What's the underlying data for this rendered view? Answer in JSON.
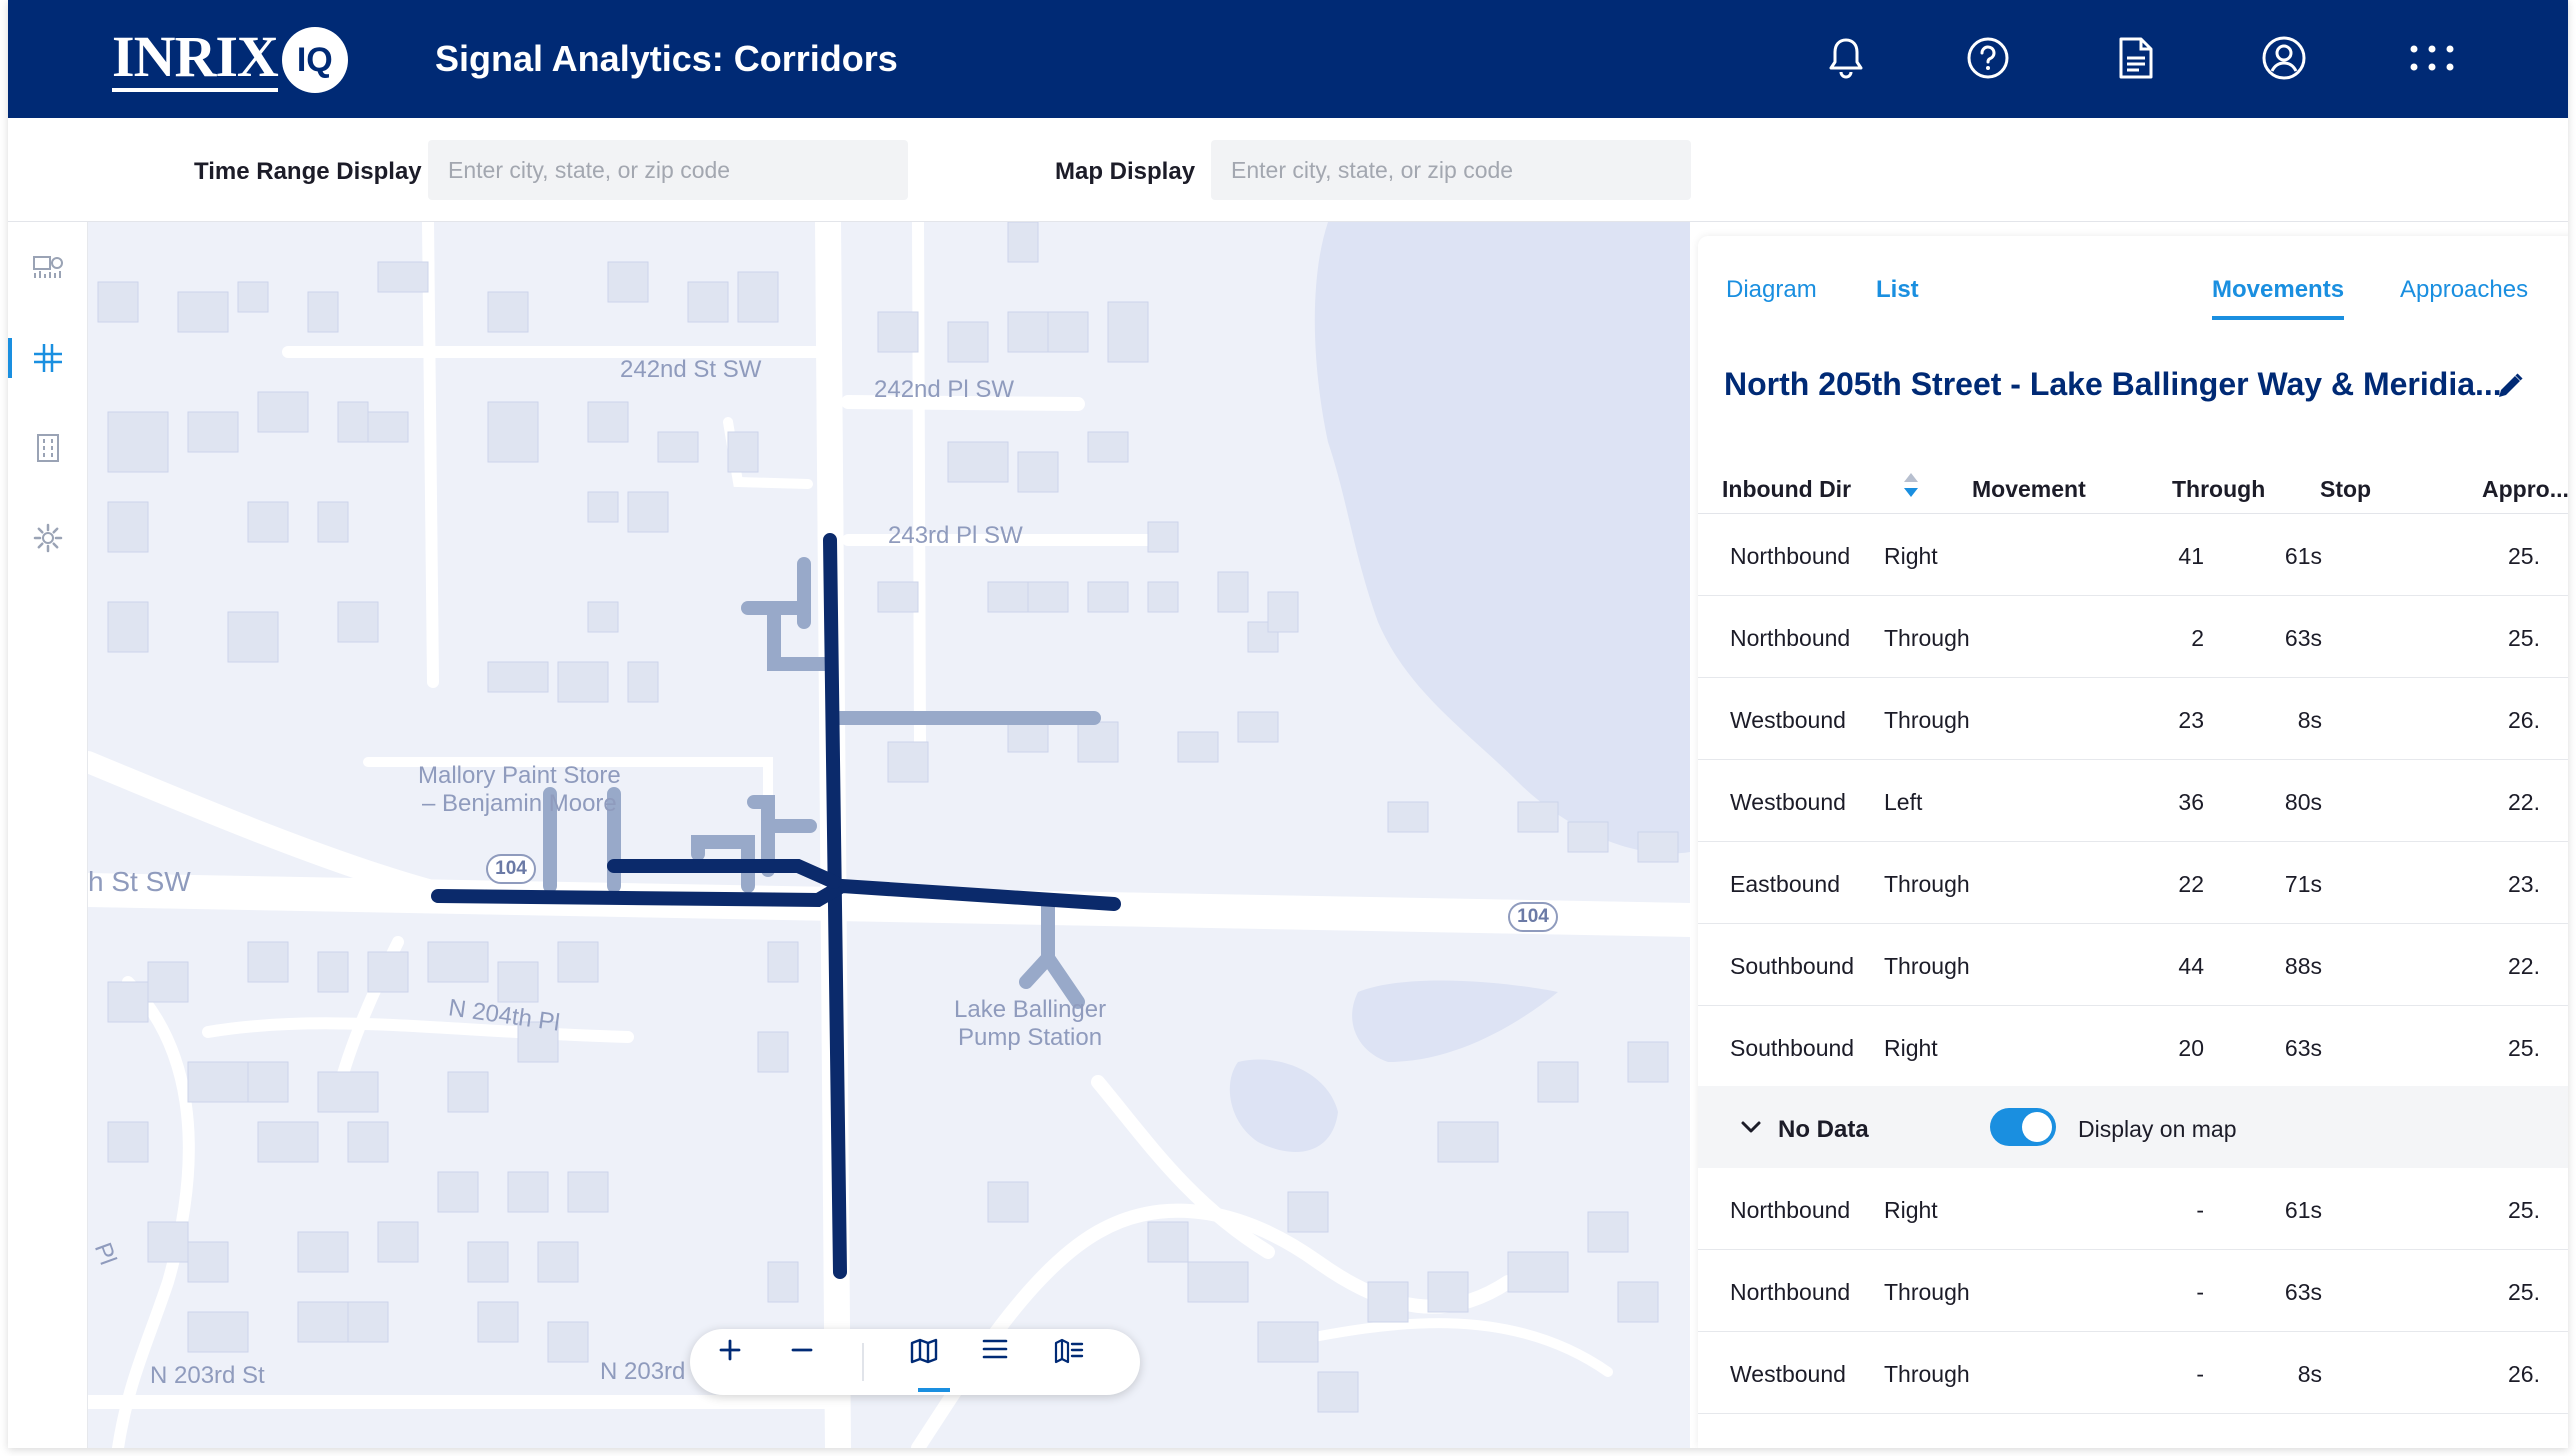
{
  "header": {
    "logo_text": "INRIX",
    "logo_badge": "IQ",
    "title": "Signal Analytics: Corridors",
    "icons": [
      "bell-icon",
      "help-icon",
      "document-icon",
      "account-icon",
      "apps-grid-icon"
    ]
  },
  "filters": {
    "time_range_label": "Time Range Display",
    "time_range_placeholder": "Enter city, state, or zip code",
    "map_display_label": "Map Display",
    "map_display_placeholder": "Enter city, state, or zip code"
  },
  "rail": {
    "items": [
      "dashboard-icon",
      "intersection-icon",
      "corridor-list-icon",
      "settings-icon"
    ],
    "active_index": 1
  },
  "map": {
    "labels": {
      "street_242nd_st": "242nd St SW",
      "street_242nd_pl": "242nd Pl SW",
      "street_243rd_pl": "243rd Pl SW",
      "street_st_sw": "h St SW",
      "street_204th": "N 204th Pl",
      "street_203rd_st": "N 203rd St",
      "street_203rd": "N 203rd",
      "street_pl": "Pl"
    },
    "poi": {
      "mallory_line1": "Mallory Paint Store",
      "mallory_line2": "– Benjamin Moore",
      "pump_line1": "Lake Ballinger",
      "pump_line2": "Pump Station"
    },
    "shields": [
      "104",
      "104"
    ],
    "toolbar": [
      "zoom-in-icon",
      "zoom-out-icon",
      "map-view-icon",
      "list-view-icon",
      "split-view-icon"
    ],
    "colors": {
      "corridor": "#0b2a6b",
      "approach": "#98a9c9",
      "water": "#dde3f4",
      "road": "#ffffff"
    }
  },
  "panel": {
    "tabs": {
      "diagram": "Diagram",
      "list": "List",
      "movements": "Movements",
      "approaches": "Approaches"
    },
    "title": "North 205th Street - Lake Ballinger Way & Meridia...",
    "columns": {
      "inbound": "Inbound Dir",
      "movement": "Movement",
      "through": "Through",
      "stop": "Stop",
      "approach": "Appro..."
    },
    "rows": [
      {
        "inbound": "Northbound",
        "movement": "Right",
        "through": "41",
        "stop": "61s",
        "approach": "25."
      },
      {
        "inbound": "Northbound",
        "movement": "Through",
        "through": "2",
        "stop": "63s",
        "approach": "25."
      },
      {
        "inbound": "Westbound",
        "movement": "Through",
        "through": "23",
        "stop": "8s",
        "approach": "26."
      },
      {
        "inbound": "Westbound",
        "movement": "Left",
        "through": "36",
        "stop": "80s",
        "approach": "22."
      },
      {
        "inbound": "Eastbound",
        "movement": "Through",
        "through": "22",
        "stop": "71s",
        "approach": "23."
      },
      {
        "inbound": "Southbound",
        "movement": "Through",
        "through": "44",
        "stop": "88s",
        "approach": "22."
      },
      {
        "inbound": "Southbound",
        "movement": "Right",
        "through": "20",
        "stop": "63s",
        "approach": "25."
      }
    ],
    "no_data_group": {
      "label": "No Data",
      "toggle_label": "Display on map",
      "toggle_on": true
    },
    "no_data_rows": [
      {
        "inbound": "Northbound",
        "movement": "Right",
        "through": "-",
        "stop": "61s",
        "approach": "25."
      },
      {
        "inbound": "Northbound",
        "movement": "Through",
        "through": "-",
        "stop": "63s",
        "approach": "25."
      },
      {
        "inbound": "Westbound",
        "movement": "Through",
        "through": "-",
        "stop": "8s",
        "approach": "26."
      }
    ],
    "accent_color": "#1a8fe0",
    "title_color": "#002a75"
  }
}
